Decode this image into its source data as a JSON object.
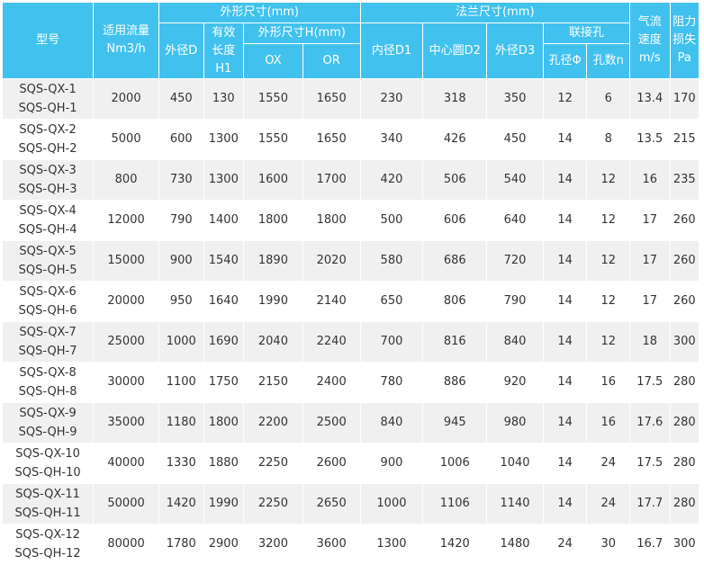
{
  "headers": {
    "model": "型号",
    "flow_line1": "适用流量",
    "flow_line2": "Nm3/h",
    "outer_size": "外形尺寸(mm)",
    "flange_size": "法兰尺寸(mm)",
    "velocity_line1": "气流",
    "velocity_line2": "速度",
    "velocity_line3": "m/s",
    "resistance_line1": "阻力",
    "resistance_line2": "损失",
    "resistance_line3": "Pa",
    "outer_d": "外径D",
    "eff_len_line1": "有效",
    "eff_len_line2": "长度",
    "eff_len_line3": "H1",
    "outer_h": "外形尺寸H(mm)",
    "inner_d1": "内径D1",
    "center_d2": "中心圆D2",
    "outer_d3": "外径D3",
    "bolt_holes": "联接孔",
    "ox": "OX",
    "or": "OR",
    "hole_dia": "孔径Φ",
    "hole_count": "孔数n"
  },
  "rows": [
    {
      "m1": "SQS-QX-1",
      "m2": "SQS-QH-1",
      "flow": "2000",
      "d": "450",
      "h1": "130",
      "ox": "1550",
      "or": "1650",
      "d1": "230",
      "d2": "318",
      "d3": "350",
      "phi": "12",
      "n": "6",
      "v": "13.4",
      "pa": "170"
    },
    {
      "m1": "SQS-QX-2",
      "m2": "SQS-QH-2",
      "flow": "5000",
      "d": "600",
      "h1": "1300",
      "ox": "1550",
      "or": "1650",
      "d1": "340",
      "d2": "426",
      "d3": "450",
      "phi": "14",
      "n": "8",
      "v": "13.5",
      "pa": "215"
    },
    {
      "m1": "SQS-QX-3",
      "m2": "SQS-QH-3",
      "flow": "800",
      "d": "730",
      "h1": "1300",
      "ox": "1600",
      "or": "1700",
      "d1": "420",
      "d2": "506",
      "d3": "540",
      "phi": "14",
      "n": "12",
      "v": "16",
      "pa": "235"
    },
    {
      "m1": "SQS-QX-4",
      "m2": "SQS-QH-4",
      "flow": "12000",
      "d": "790",
      "h1": "1400",
      "ox": "1800",
      "or": "1800",
      "d1": "500",
      "d2": "606",
      "d3": "640",
      "phi": "14",
      "n": "12",
      "v": "17",
      "pa": "260"
    },
    {
      "m1": "SQS-QX-5",
      "m2": "SQS-QH-5",
      "flow": "15000",
      "d": "900",
      "h1": "1540",
      "ox": "1890",
      "or": "2020",
      "d1": "580",
      "d2": "686",
      "d3": "720",
      "phi": "14",
      "n": "12",
      "v": "17",
      "pa": "260"
    },
    {
      "m1": "SQS-QX-6",
      "m2": "SQS-QH-6",
      "flow": "20000",
      "d": "950",
      "h1": "1640",
      "ox": "1990",
      "or": "2140",
      "d1": "650",
      "d2": "806",
      "d3": "790",
      "phi": "14",
      "n": "12",
      "v": "17",
      "pa": "260"
    },
    {
      "m1": "SQS-QX-7",
      "m2": "SQS-QH-7",
      "flow": "25000",
      "d": "1000",
      "h1": "1690",
      "ox": "2040",
      "or": "2240",
      "d1": "700",
      "d2": "816",
      "d3": "840",
      "phi": "14",
      "n": "12",
      "v": "18",
      "pa": "300"
    },
    {
      "m1": "SQS-QX-8",
      "m2": "SQS-QH-8",
      "flow": "30000",
      "d": "1100",
      "h1": "1750",
      "ox": "2150",
      "or": "2400",
      "d1": "780",
      "d2": "886",
      "d3": "920",
      "phi": "14",
      "n": "16",
      "v": "17.5",
      "pa": "280"
    },
    {
      "m1": "SQS-QX-9",
      "m2": "SQS-QH-9",
      "flow": "35000",
      "d": "1180",
      "h1": "1800",
      "ox": "2200",
      "or": "2500",
      "d1": "840",
      "d2": "945",
      "d3": "980",
      "phi": "14",
      "n": "16",
      "v": "17.6",
      "pa": "280"
    },
    {
      "m1": "SQS-QX-10",
      "m2": "SQS-QH-10",
      "flow": "40000",
      "d": "1330",
      "h1": "1880",
      "ox": "2250",
      "or": "2600",
      "d1": "900",
      "d2": "1006",
      "d3": "1040",
      "phi": "14",
      "n": "24",
      "v": "17.5",
      "pa": "280"
    },
    {
      "m1": "SQS-QX-11",
      "m2": "SQS-QH-11",
      "flow": "50000",
      "d": "1420",
      "h1": "1990",
      "ox": "2250",
      "or": "2650",
      "d1": "1000",
      "d2": "1106",
      "d3": "1140",
      "phi": "14",
      "n": "24",
      "v": "17.7",
      "pa": "280"
    },
    {
      "m1": "SQS-QX-12",
      "m2": "SQS-QH-12",
      "flow": "80000",
      "d": "1780",
      "h1": "2900",
      "ox": "3200",
      "or": "3600",
      "d1": "1300",
      "d2": "1420",
      "d3": "1480",
      "phi": "24",
      "n": "30",
      "v": "16.7",
      "pa": "300"
    }
  ],
  "colors": {
    "header_bg": "#41c1ee",
    "header_text": "#ffffff",
    "row_alt_bg": "#f0f0f0",
    "body_text": "#333333"
  }
}
